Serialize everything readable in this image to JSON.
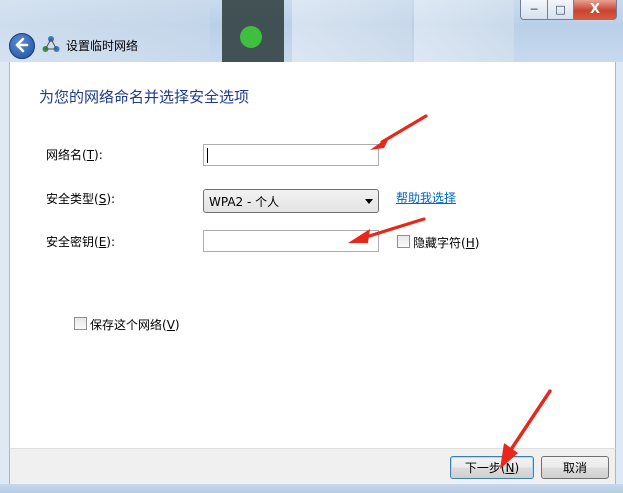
{
  "window": {
    "title": "设置临时网络",
    "controls": {
      "minimize": "─",
      "maximize": "□",
      "close": "X"
    }
  },
  "page": {
    "heading": "为您的网络命名并选择安全选项"
  },
  "form": {
    "network_name": {
      "label": "网络名(",
      "accel": "T",
      "suffix": "):",
      "value": ""
    },
    "security_type": {
      "label": "安全类型(",
      "accel": "S",
      "suffix": "):",
      "selected": "WPA2 - 个人"
    },
    "help_link": "帮助我选择",
    "security_key": {
      "label": "安全密钥(",
      "accel": "E",
      "suffix": "):",
      "value": ""
    },
    "hide_characters": {
      "label": "隐藏字符(",
      "accel": "H",
      "suffix": ")",
      "checked": false
    },
    "save_network": {
      "label": "保存这个网络(",
      "accel": "V",
      "suffix": ")",
      "checked": false
    }
  },
  "footer": {
    "next": {
      "label": "下一步(",
      "accel": "N",
      "suffix": ")"
    },
    "cancel": "取消"
  },
  "annotations": {
    "arrow_color": "#e8271a"
  }
}
